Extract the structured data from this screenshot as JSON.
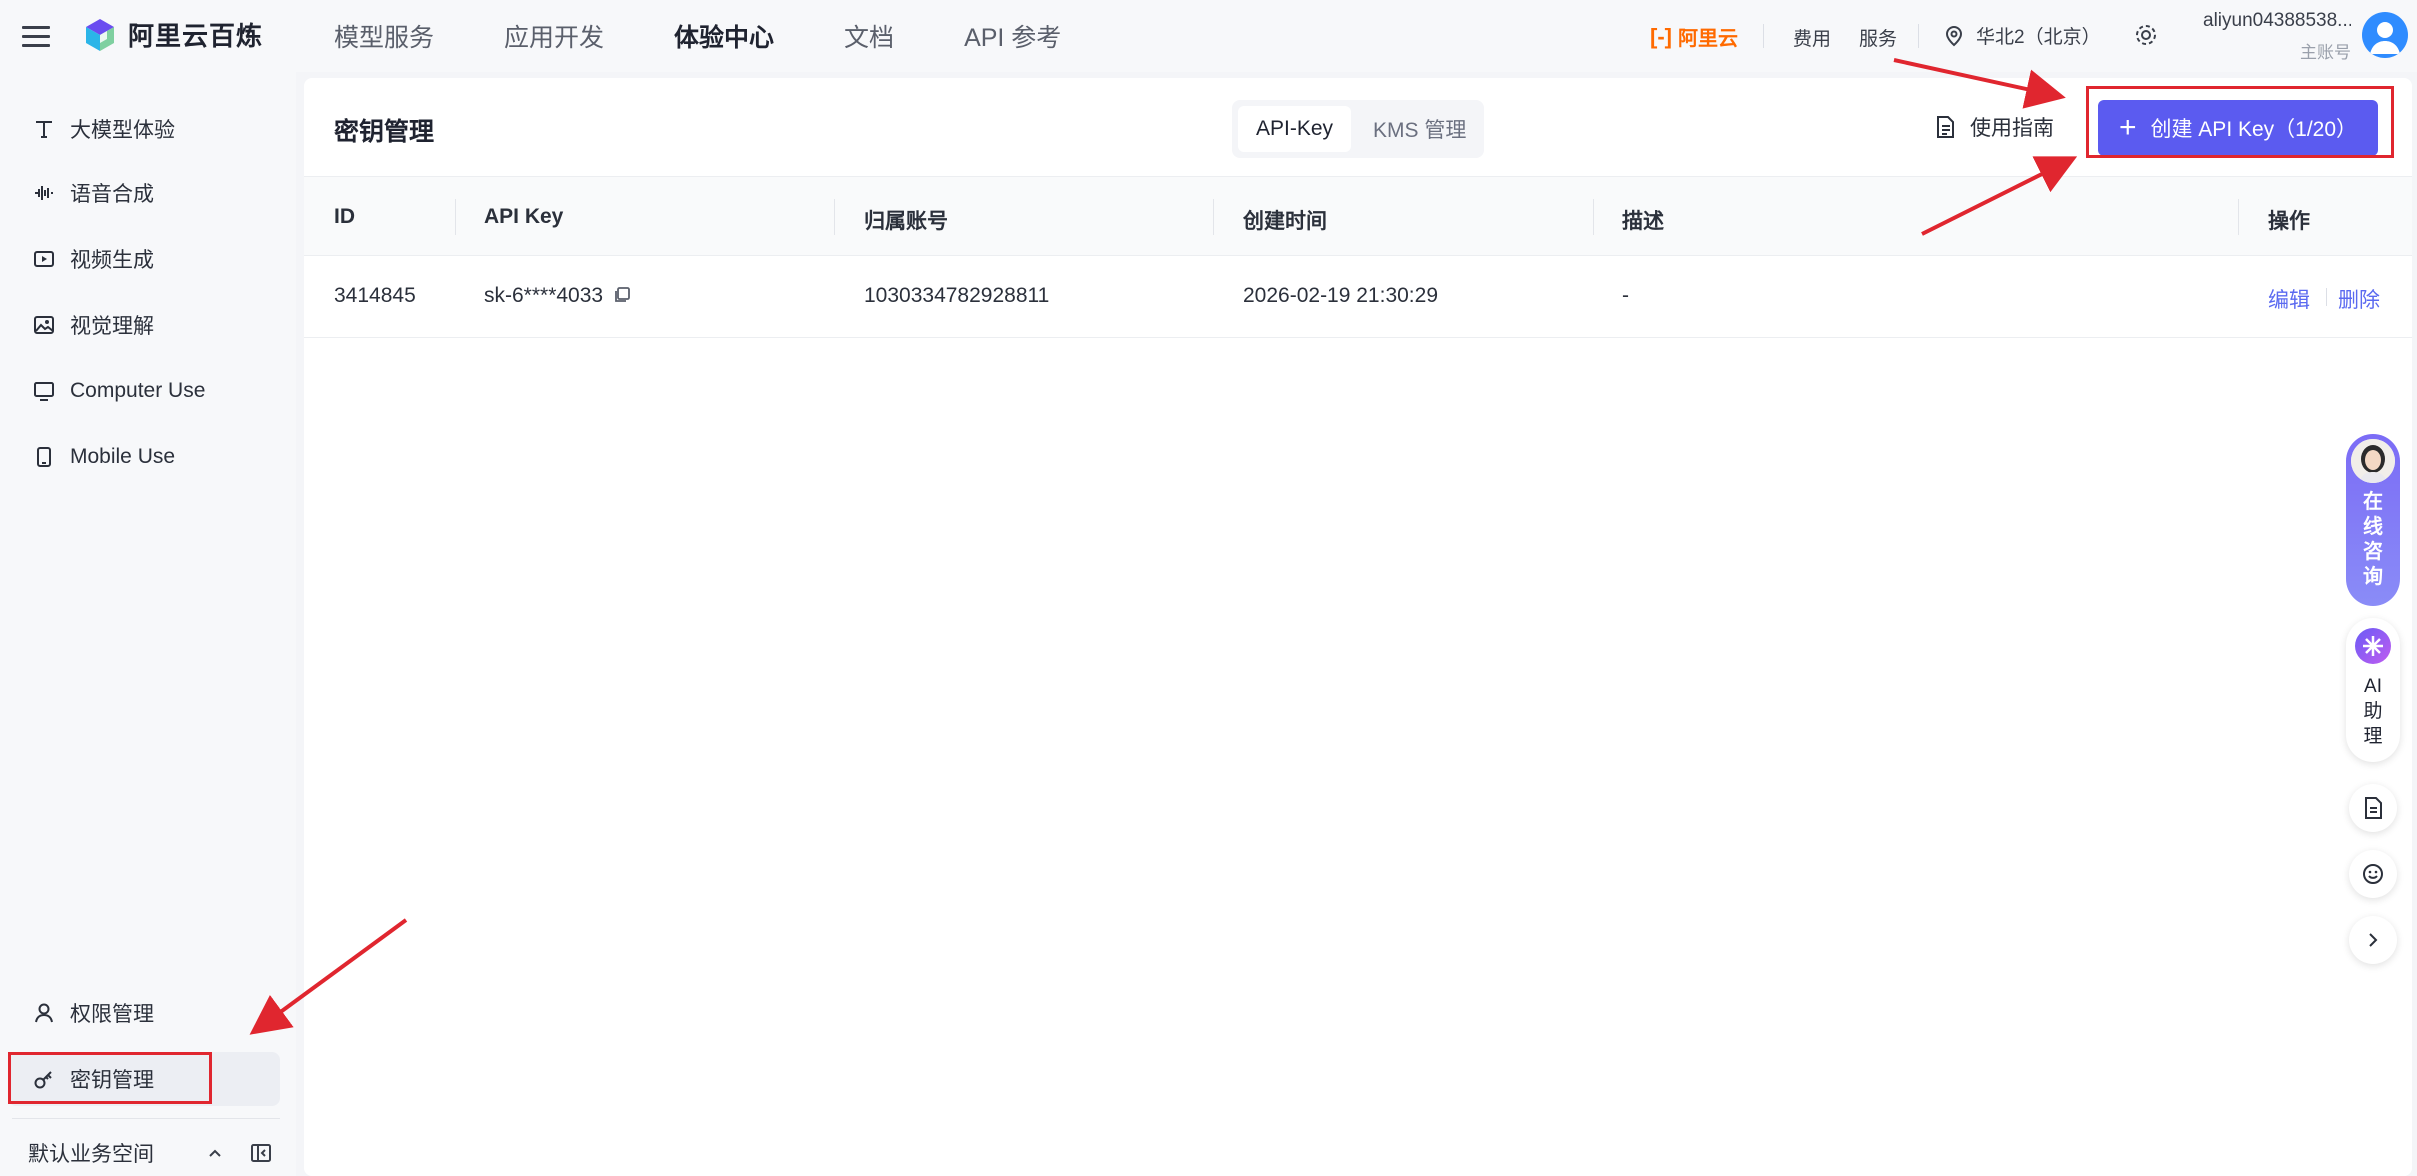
{
  "brand": {
    "name": "阿里云百炼"
  },
  "topnav": {
    "items": [
      "模型服务",
      "应用开发",
      "体验中心",
      "文档",
      "API 参考"
    ],
    "active": "体验中心"
  },
  "header_right": {
    "aliyun_logo": "阿里云",
    "fee": "费用",
    "service": "服务",
    "region": "华北2（北京）",
    "account_name": "aliyun04388538...",
    "account_role": "主账号"
  },
  "sidebar": {
    "items": [
      {
        "label": "大模型体验",
        "icon": "text-icon"
      },
      {
        "label": "语音合成",
        "icon": "waveform-icon"
      },
      {
        "label": "视频生成",
        "icon": "video-icon"
      },
      {
        "label": "视觉理解",
        "icon": "image-icon"
      },
      {
        "label": "Computer Use",
        "icon": "monitor-icon"
      },
      {
        "label": "Mobile Use",
        "icon": "phone-icon"
      }
    ],
    "bottom_items": [
      {
        "label": "权限管理",
        "icon": "user-icon"
      },
      {
        "label": "密钥管理",
        "icon": "key-icon",
        "active": true
      }
    ],
    "workspace": "默认业务空间"
  },
  "page": {
    "title": "密钥管理",
    "tabs": [
      "API-Key",
      "KMS 管理"
    ],
    "active_tab": "API-Key",
    "guide_label": "使用指南",
    "create_button": "创建 API Key（1/20）"
  },
  "table": {
    "columns": [
      "ID",
      "API Key",
      "归属账号",
      "创建时间",
      "描述",
      "操作"
    ],
    "rows": [
      {
        "id": "3414845",
        "api_key": "sk-6****4033",
        "account": "1030334782928811",
        "created": "2026-02-19 21:30:29",
        "desc": "-",
        "actions": [
          "编辑",
          "删除"
        ]
      }
    ]
  },
  "floating": {
    "consult_label": [
      "在",
      "线",
      "咨",
      "询"
    ],
    "ai_label": [
      "AI",
      "助",
      "理"
    ]
  },
  "colors": {
    "accent": "#5b5bf0",
    "annotation": "#e0262f",
    "aliyun_orange": "#ff6a00"
  }
}
